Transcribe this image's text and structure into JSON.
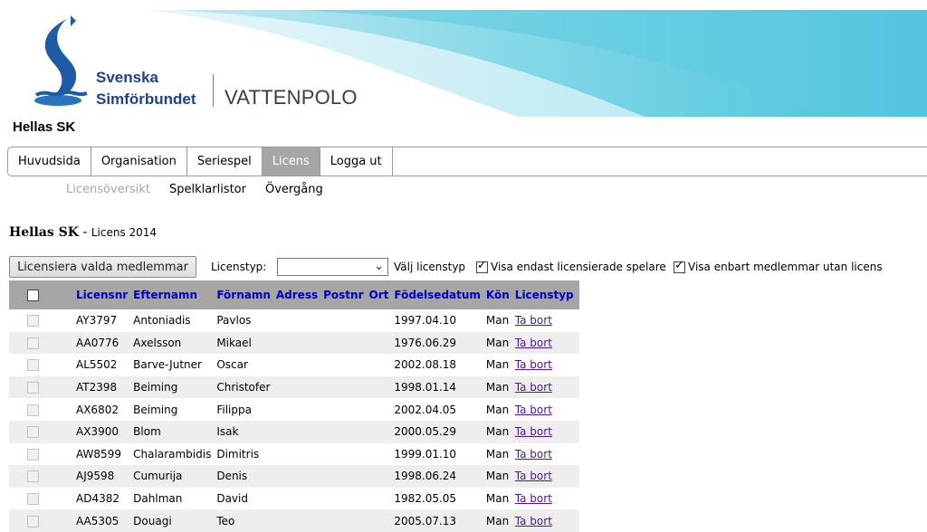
{
  "brand": {
    "line1": "Svenska",
    "line2": "Simförbundet",
    "sport": "VATTENPOLO"
  },
  "club_title": "Hellas SK",
  "nav": {
    "items": [
      "Huvudsida",
      "Organisation",
      "Seriespel",
      "Licens",
      "Logga ut"
    ],
    "active": "Licens"
  },
  "subnav": {
    "items": [
      "Licensöversikt",
      "Spelklarlistor",
      "Övergång"
    ],
    "active": "Licensöversikt"
  },
  "section": {
    "club": "Hellas SK",
    "separator": " - ",
    "sub": "Licens 2014"
  },
  "toolbar": {
    "licensiera_button": "Licensiera valda medlemmar",
    "licenstyp_label": "Licenstyp:",
    "licenstyp_value": "",
    "valj_label": "Välj licenstyp",
    "filter1_label": "Visa endast licensierade spelare",
    "filter1_checked": true,
    "filter2_label": "Visa enbart medlemmar utan licens",
    "filter2_checked": true
  },
  "table": {
    "columns": [
      "Licensnr",
      "Efternamn",
      "Förnamn",
      "Adress",
      "Postnr",
      "Ort",
      "Födelsedatum",
      "Kön",
      "Licenstyp"
    ],
    "rows": [
      {
        "licensnr": "AY3797",
        "efternamn": "Antoniadis",
        "fornamn": "Pavlos",
        "adress": "",
        "postnr": "",
        "ort": "",
        "fodelsedatum": "1997.04.10",
        "kon": "Man",
        "action": "Ta bort"
      },
      {
        "licensnr": "AA0776",
        "efternamn": "Axelsson",
        "fornamn": "Mikael",
        "adress": "",
        "postnr": "",
        "ort": "",
        "fodelsedatum": "1976.06.29",
        "kon": "Man",
        "action": "Ta bort"
      },
      {
        "licensnr": "AL5502",
        "efternamn": "Barve-Jutner",
        "fornamn": "Oscar",
        "adress": "",
        "postnr": "",
        "ort": "",
        "fodelsedatum": "2002.08.18",
        "kon": "Man",
        "action": "Ta bort"
      },
      {
        "licensnr": "AT2398",
        "efternamn": "Beiming",
        "fornamn": "Christofer",
        "adress": "",
        "postnr": "",
        "ort": "",
        "fodelsedatum": "1998.01.14",
        "kon": "Man",
        "action": "Ta bort"
      },
      {
        "licensnr": "AX6802",
        "efternamn": "Beiming",
        "fornamn": "Filippa",
        "adress": "",
        "postnr": "",
        "ort": "",
        "fodelsedatum": "2002.04.05",
        "kon": "Man",
        "action": "Ta bort"
      },
      {
        "licensnr": "AX3900",
        "efternamn": "Blom",
        "fornamn": "Isak",
        "adress": "",
        "postnr": "",
        "ort": "",
        "fodelsedatum": "2000.05.29",
        "kon": "Man",
        "action": "Ta bort"
      },
      {
        "licensnr": "AW8599",
        "efternamn": "Chalarambidis",
        "fornamn": "Dimitris",
        "adress": "",
        "postnr": "",
        "ort": "",
        "fodelsedatum": "1999.01.10",
        "kon": "Man",
        "action": "Ta bort"
      },
      {
        "licensnr": "AJ9598",
        "efternamn": "Cumurija",
        "fornamn": "Denis",
        "adress": "",
        "postnr": "",
        "ort": "",
        "fodelsedatum": "1998.06.24",
        "kon": "Man",
        "action": "Ta bort"
      },
      {
        "licensnr": "AD4382",
        "efternamn": "Dahlman",
        "fornamn": "David",
        "adress": "",
        "postnr": "",
        "ort": "",
        "fodelsedatum": "1982.05.05",
        "kon": "Man",
        "action": "Ta bort"
      },
      {
        "licensnr": "AA5305",
        "efternamn": "Douagi",
        "fornamn": "Teo",
        "adress": "",
        "postnr": "",
        "ort": "",
        "fodelsedatum": "2005.07.13",
        "kon": "Man",
        "action": "Ta bort"
      }
    ]
  },
  "colors": {
    "brand_blue": "#1f3f91",
    "header_grey": "#a6a6a6",
    "header_text": "#0000cc",
    "link_visited": "#4a1a8c",
    "row_alt": "#eeeeee",
    "banner_cyan": "#4fc6dc"
  }
}
